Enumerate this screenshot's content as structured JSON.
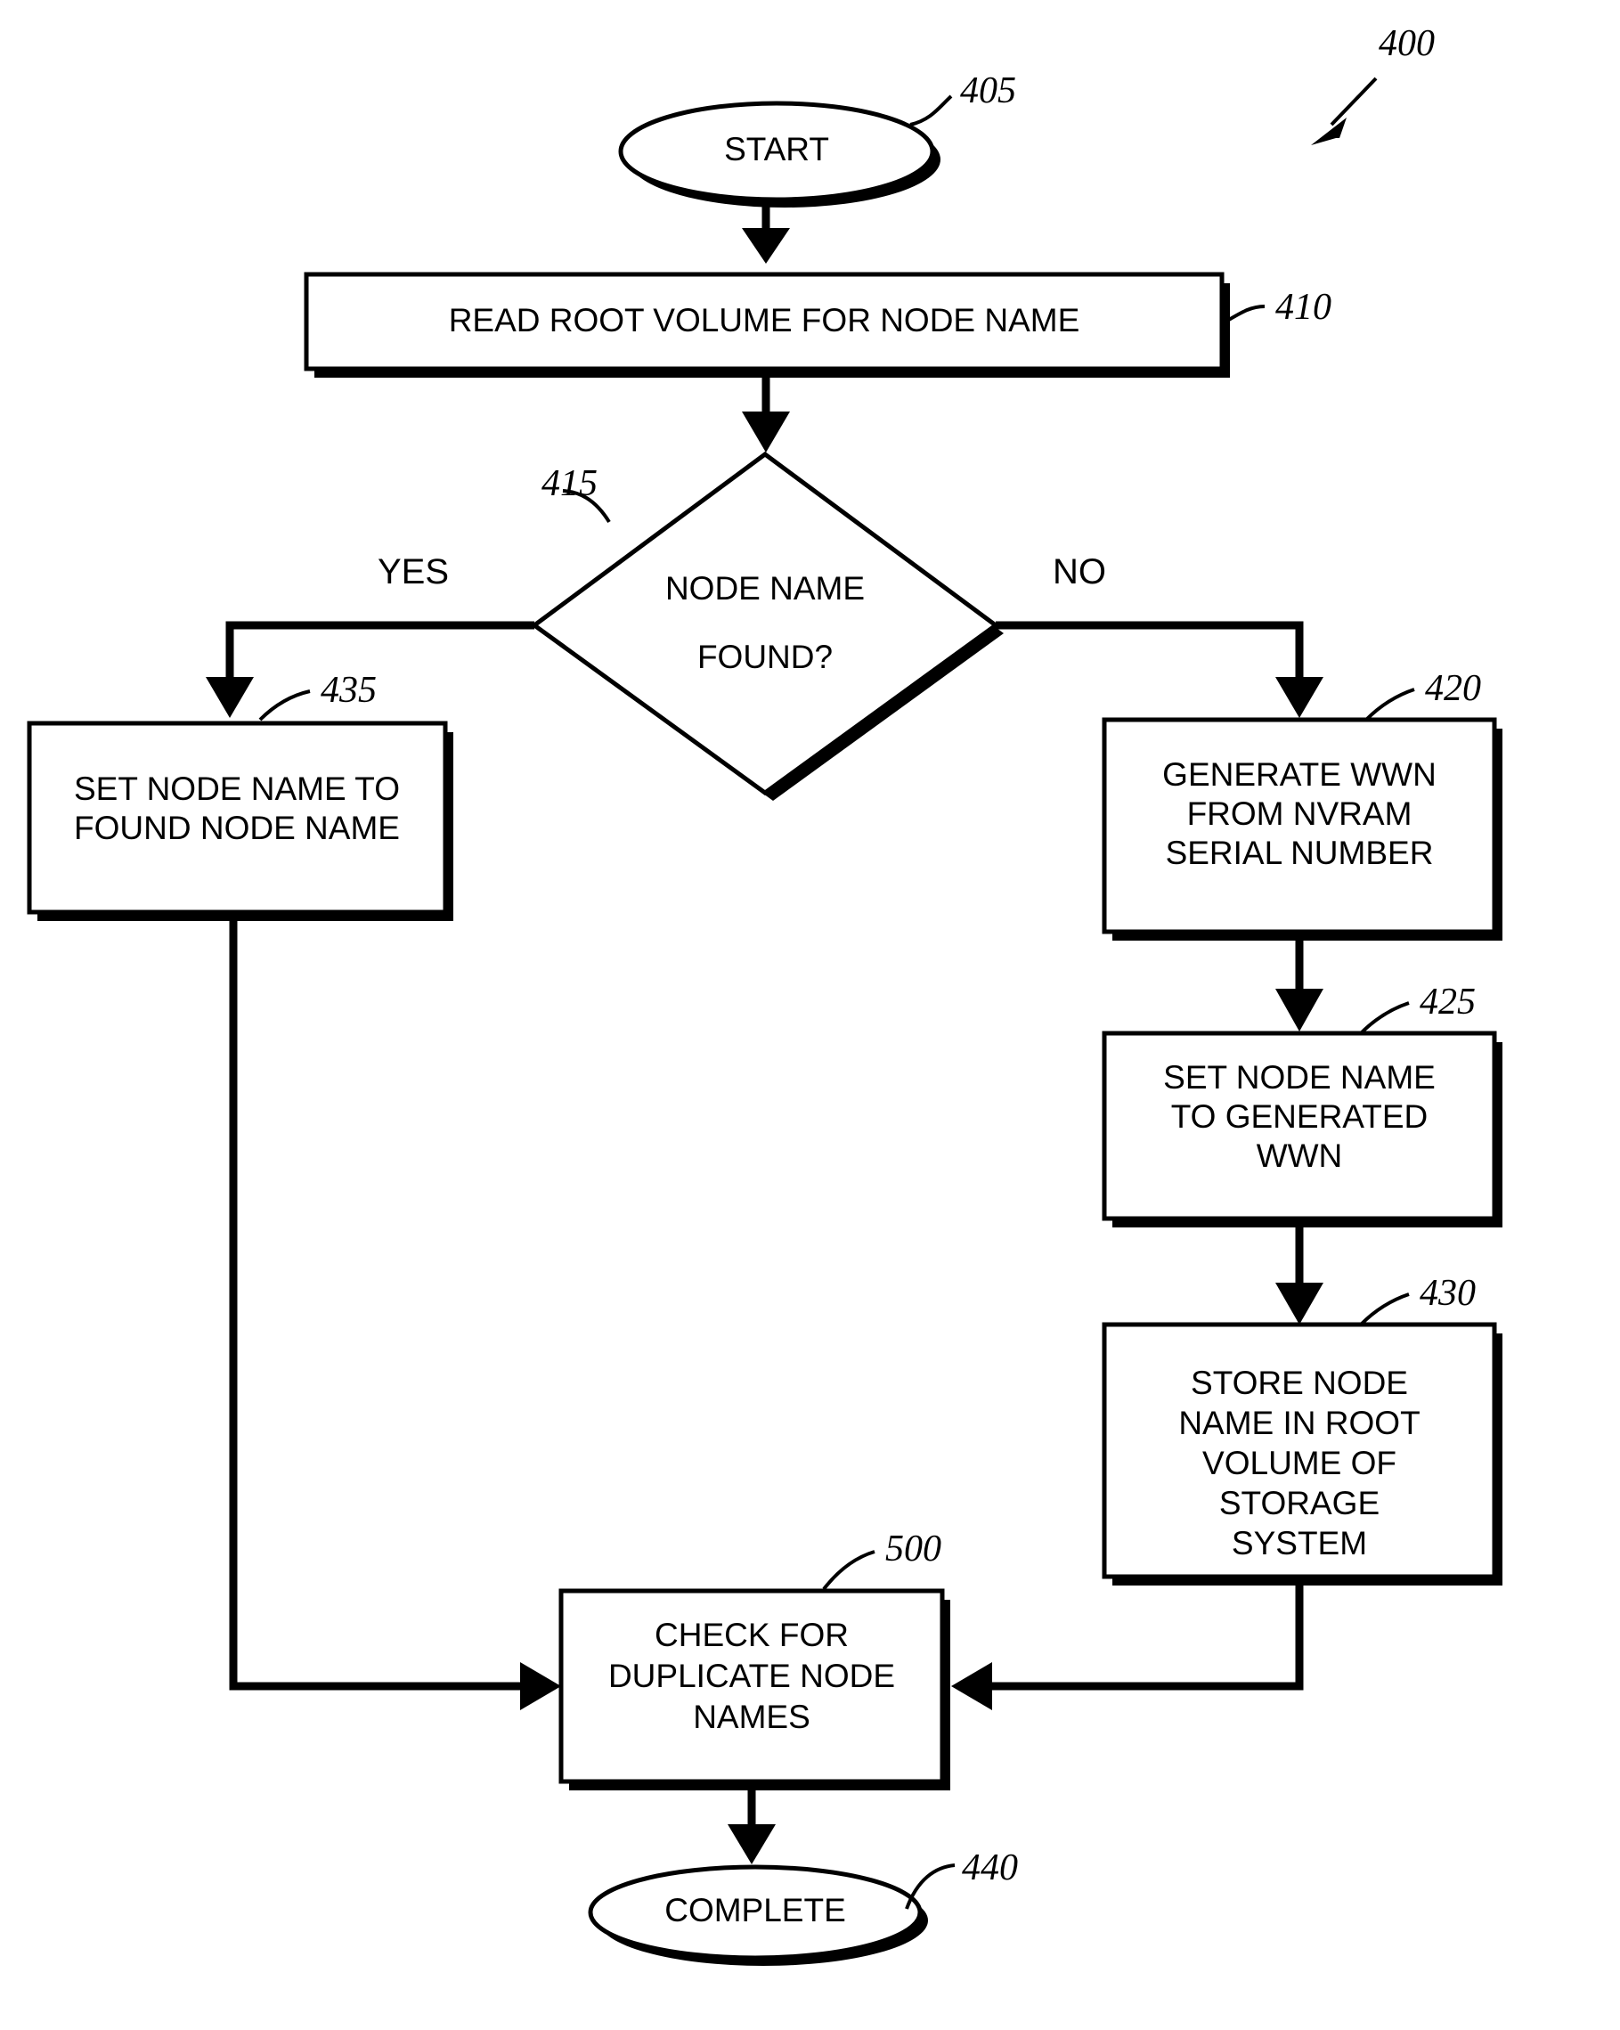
{
  "figure": {
    "ref_label": "400",
    "nodes": [
      {
        "id": "start",
        "ref": "405",
        "kind": "terminator",
        "lines": [
          "START"
        ]
      },
      {
        "id": "read",
        "ref": "410",
        "kind": "process",
        "lines": [
          "READ ROOT VOLUME FOR NODE NAME"
        ]
      },
      {
        "id": "decide",
        "ref": "415",
        "kind": "decision",
        "lines": [
          "NODE NAME",
          "FOUND?"
        ]
      },
      {
        "id": "setfound",
        "ref": "435",
        "kind": "process",
        "lines": [
          "SET NODE NAME TO",
          "FOUND NODE NAME"
        ]
      },
      {
        "id": "genwwn",
        "ref": "420",
        "kind": "process",
        "lines": [
          "GENERATE WWN",
          "FROM NVRAM",
          "SERIAL NUMBER"
        ]
      },
      {
        "id": "setwwn",
        "ref": "425",
        "kind": "process",
        "lines": [
          "SET NODE NAME",
          "TO GENERATED",
          "WWN"
        ]
      },
      {
        "id": "store",
        "ref": "430",
        "kind": "process",
        "lines": [
          "STORE NODE",
          "NAME IN ROOT",
          "VOLUME OF",
          "STORAGE",
          "SYSTEM"
        ]
      },
      {
        "id": "check",
        "ref": "500",
        "kind": "process",
        "lines": [
          "CHECK FOR",
          "DUPLICATE NODE",
          "NAMES"
        ]
      },
      {
        "id": "complete",
        "ref": "440",
        "kind": "terminator",
        "lines": [
          "COMPLETE"
        ]
      }
    ],
    "branch_labels": {
      "yes": "YES",
      "no": "NO"
    },
    "colors": {
      "ink": "#000000",
      "paper": "#ffffff"
    }
  },
  "text": {
    "start": "START",
    "read": "READ ROOT VOLUME FOR NODE NAME",
    "decide_l1": "NODE NAME",
    "decide_l2": "FOUND?",
    "yes": "YES",
    "no": "NO",
    "setfound_l1": "SET NODE NAME TO",
    "setfound_l2": "FOUND NODE NAME",
    "genwwn_l1": "GENERATE WWN",
    "genwwn_l2": "FROM NVRAM",
    "genwwn_l3": "SERIAL NUMBER",
    "setwwn_l1": "SET NODE NAME",
    "setwwn_l2": "TO GENERATED",
    "setwwn_l3": "WWN",
    "store_l1": "STORE NODE",
    "store_l2": "NAME IN ROOT",
    "store_l3": "VOLUME OF",
    "store_l4": "STORAGE",
    "store_l5": "SYSTEM",
    "check_l1": "CHECK FOR",
    "check_l2": "DUPLICATE NODE",
    "check_l3": "NAMES",
    "complete": "COMPLETE"
  },
  "refs": {
    "fig": "400",
    "start": "405",
    "read": "410",
    "decide": "415",
    "setfound": "435",
    "genwwn": "420",
    "setwwn": "425",
    "store": "430",
    "check": "500",
    "complete": "440"
  }
}
